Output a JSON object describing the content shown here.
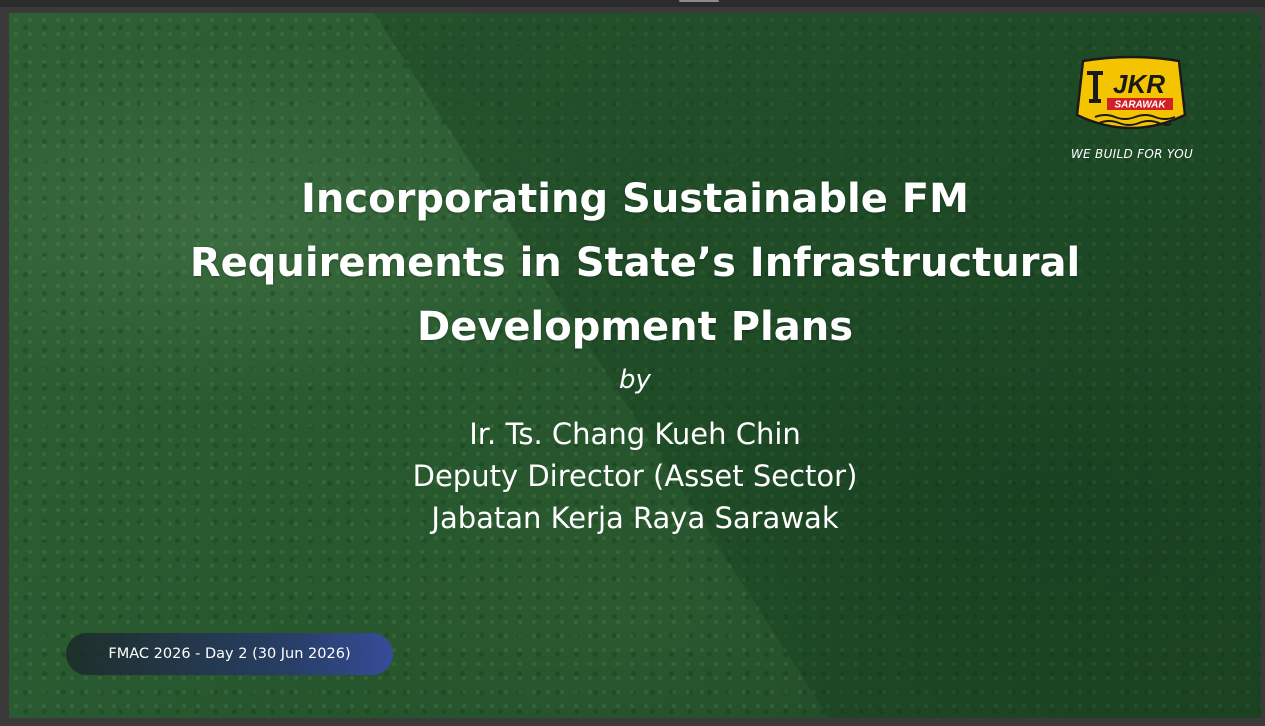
{
  "logo": {
    "brand": "JKR",
    "sub_brand": "SARAWAK",
    "tagline": "WE BUILD FOR YOU",
    "colors": {
      "fill": "#f5c400",
      "border": "#1a1a1a",
      "ribbon": "#d21f26"
    }
  },
  "slide": {
    "title_lines": [
      "Incorporating Sustainable FM",
      "Requirements in State’s Infrastructural",
      "Development Plans"
    ],
    "by": "by",
    "presenter": {
      "name": "Ir. Ts. Chang Kueh Chin",
      "position": "Deputy Director (Asset Sector)",
      "organization": "Jabatan Kerja Raya Sarawak"
    },
    "event_badge": "FMAC 2026 - Day 2 (30 Jun 2026)"
  },
  "colors": {
    "background_green": "#2a5a31",
    "text": "#ffffff",
    "badge_blue": "#374ba0"
  }
}
